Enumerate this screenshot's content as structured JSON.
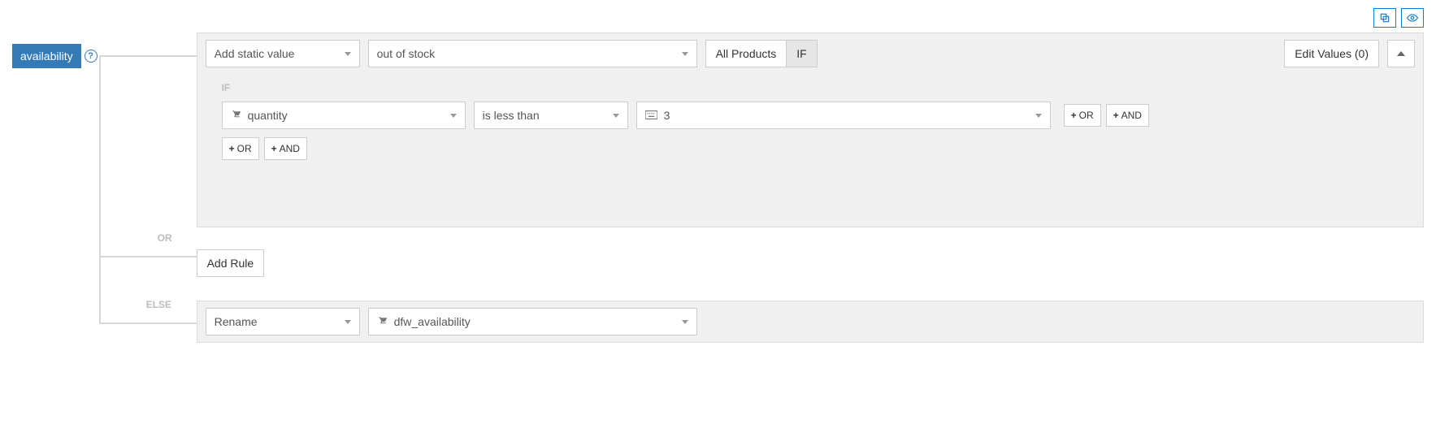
{
  "tag": "availability",
  "topRow": {
    "action": "Add static value",
    "value": "out of stock",
    "scope": "All Products",
    "ifTab": "IF",
    "editValues": "Edit Values (0)"
  },
  "condition": {
    "label": "IF",
    "field": "quantity",
    "operator": "is less than",
    "value": "3",
    "orBtn": "OR",
    "andBtn": "AND"
  },
  "orLabel": "OR",
  "addRule": "Add Rule",
  "elseLabel": "ELSE",
  "elseRow": {
    "action": "Rename",
    "value": "dfw_availability"
  }
}
